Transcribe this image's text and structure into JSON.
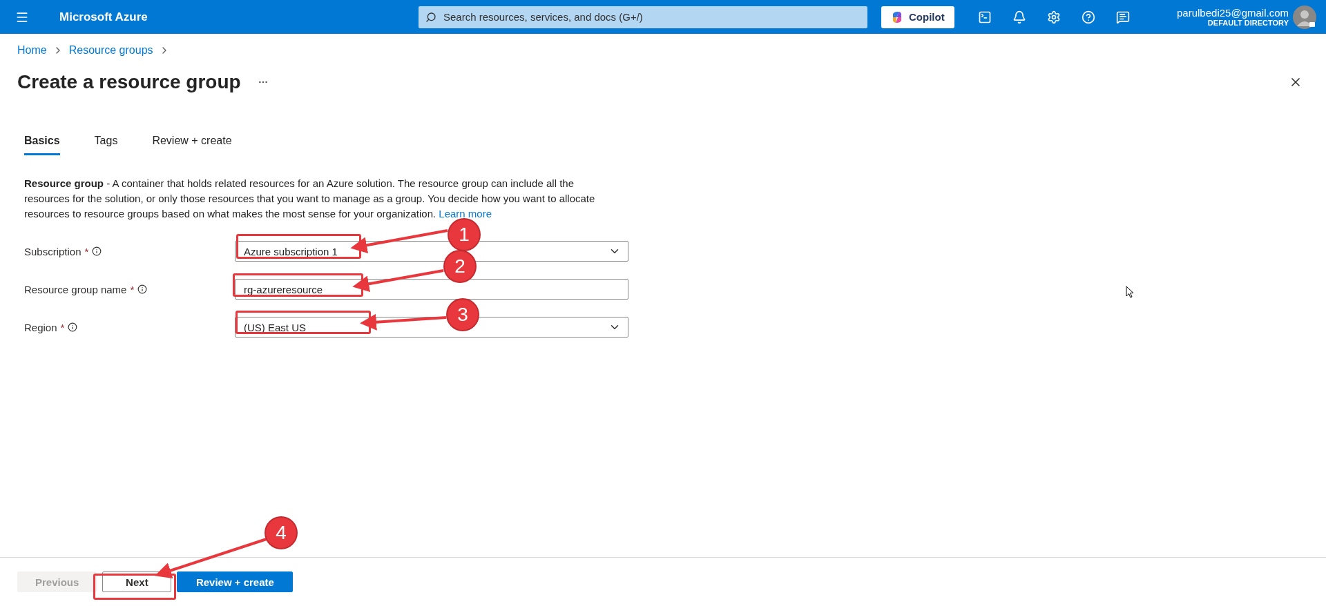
{
  "topbar": {
    "brand": "Microsoft Azure",
    "search": {
      "placeholder": "Search resources, services, and docs (G+/)"
    },
    "copilot": "Copilot",
    "account": {
      "email": "parulbedi25@gmail.com",
      "directory": "DEFAULT DIRECTORY"
    }
  },
  "breadcrumb": [
    "Home",
    "Resource groups"
  ],
  "title": "Create a resource group",
  "tabs": [
    {
      "label": "Basics",
      "selected": true
    },
    {
      "label": "Tags",
      "selected": false
    },
    {
      "label": "Review + create",
      "selected": false
    }
  ],
  "description": {
    "text": "**Resource group** - A container that holds related resources for an Azure solution. The resource group can include all the resources for the solution, or only those resources that you want to manage as a group. You decide how you want to allocate resources to resource groups based on what makes the most sense for your organization.",
    "link": "Learn more"
  },
  "fields": [
    {
      "kind": "select",
      "label": "Subscription",
      "required_mark": "*",
      "value": "Azure subscription 1"
    },
    {
      "kind": "text",
      "label": "Resource group name",
      "required_mark": "*",
      "value": "rg-azureresource"
    },
    {
      "kind": "select",
      "label": "Region",
      "required_mark": "*",
      "value": "(US) East US"
    }
  ],
  "footer": {
    "buttons": [
      {
        "label": "Previous",
        "kind": "secondary",
        "disabled": true
      },
      {
        "label": "Next",
        "kind": "secondary",
        "disabled": false
      },
      {
        "label": "Review + create",
        "kind": "primary",
        "disabled": false
      }
    ]
  },
  "annotations": [
    {
      "number": "1"
    },
    {
      "number": "2"
    },
    {
      "number": "3"
    },
    {
      "number": "4"
    }
  ]
}
